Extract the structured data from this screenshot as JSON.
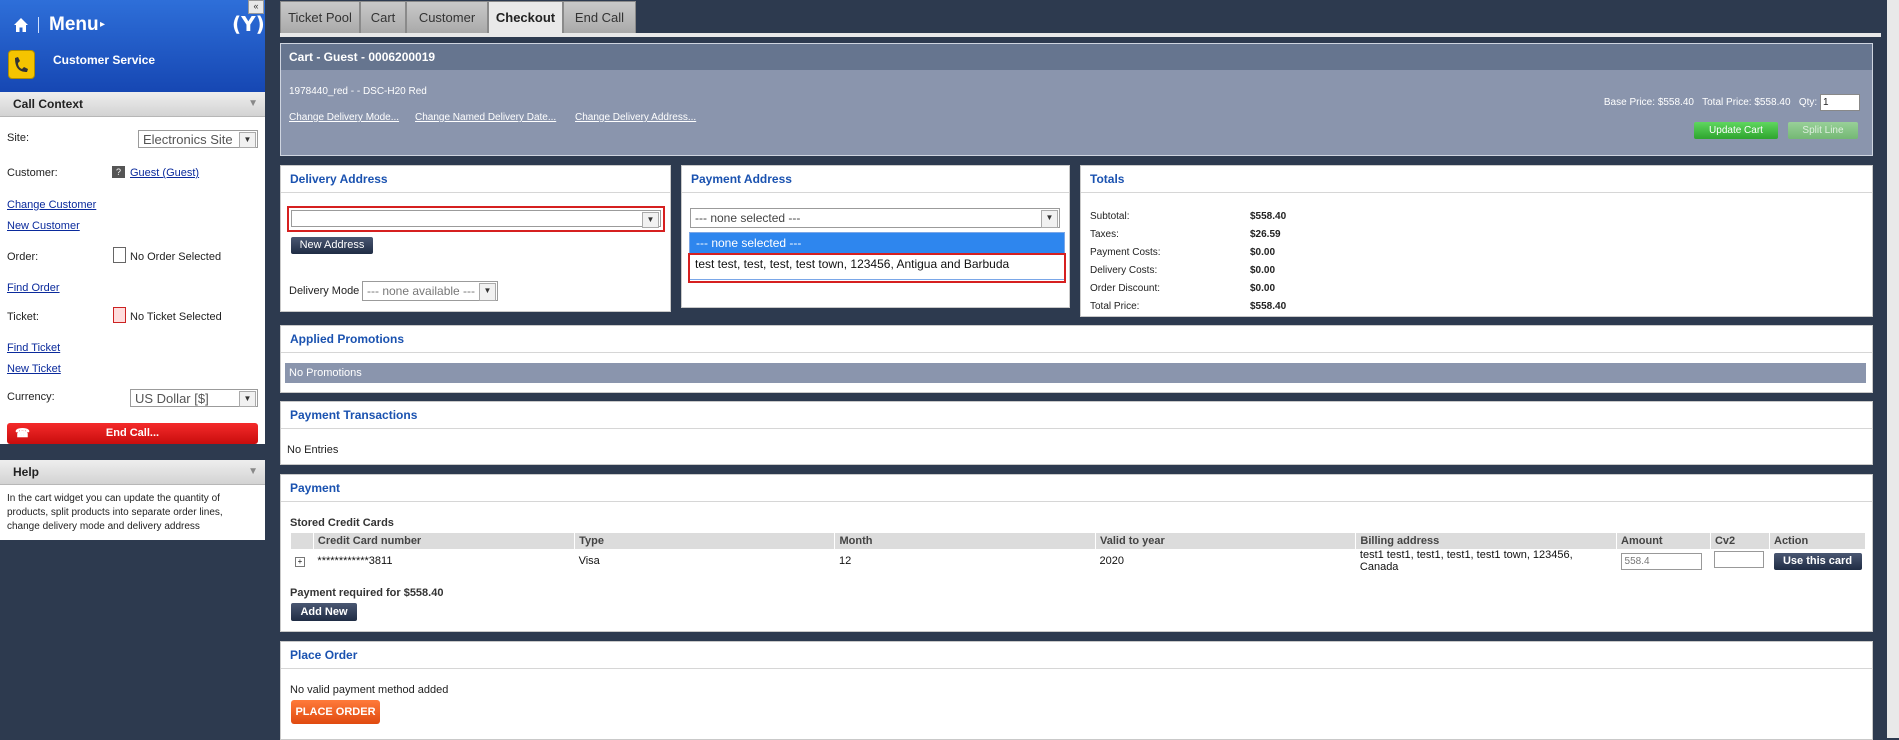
{
  "sidebar": {
    "collapse_label": "«",
    "menu_label": "Menu",
    "menu_arrow": "▸",
    "logo_text": "(Y)",
    "service_label": "Customer Service",
    "call_context": {
      "title": "Call Context",
      "site_label": "Site:",
      "site_value": "Electronics Site",
      "customer_label": "Customer:",
      "customer_value": "Guest (Guest)",
      "change_customer": "Change Customer",
      "new_customer": "New Customer",
      "order_label": "Order:",
      "order_value": "No Order Selected",
      "find_order": "Find Order",
      "ticket_label": "Ticket:",
      "ticket_value": "No Ticket Selected",
      "find_ticket": "Find Ticket",
      "new_ticket": "New Ticket",
      "currency_label": "Currency:",
      "currency_value": "US Dollar [$]",
      "end_call": "End Call..."
    },
    "help": {
      "title": "Help",
      "text": "In the cart widget you can update the quantity of products, split products into separate order lines, change delivery mode and delivery address"
    }
  },
  "tabs": [
    "Ticket Pool",
    "Cart",
    "Customer",
    "Checkout",
    "End Call"
  ],
  "active_tab": "Checkout",
  "cart": {
    "title": "Cart - Guest - 0006200019",
    "product": "1978440_red - - DSC-H20 Red",
    "links": [
      "Change Delivery Mode...",
      "Change Named Delivery Date...",
      "Change Delivery Address..."
    ],
    "base_price_label": "Base Price:",
    "base_price": "$558.40",
    "total_price_label": "Total Price:",
    "total_price": "$558.40",
    "qty_label": "Qty:",
    "qty_value": "1",
    "update_cart": "Update Cart",
    "split_line": "Split Line"
  },
  "delivery": {
    "title": "Delivery Address",
    "address_value": "",
    "new_address": "New Address",
    "mode_label": "Delivery Mode",
    "mode_value": "--- none available ---"
  },
  "payment_address": {
    "title": "Payment Address",
    "selected": "--- none selected ---",
    "options": [
      "--- none selected ---",
      "test test, test, test, test town, 123456, Antigua and Barbuda"
    ]
  },
  "totals": {
    "title": "Totals",
    "rows": [
      {
        "label": "Subtotal:",
        "value": "$558.40"
      },
      {
        "label": "Taxes:",
        "value": "$26.59"
      },
      {
        "label": "Payment Costs:",
        "value": "$0.00"
      },
      {
        "label": "Delivery Costs:",
        "value": "$0.00"
      },
      {
        "label": "Order Discount:",
        "value": "$0.00"
      },
      {
        "label": "Total Price:",
        "value": "$558.40"
      }
    ]
  },
  "promotions": {
    "title": "Applied Promotions",
    "empty": "No Promotions"
  },
  "transactions": {
    "title": "Payment Transactions",
    "empty": "No Entries"
  },
  "payment": {
    "title": "Payment",
    "stored_label": "Stored Credit Cards",
    "headers": [
      "Credit Card number",
      "Type",
      "Month",
      "Valid to year",
      "Billing address",
      "Amount",
      "Cv2",
      "Action"
    ],
    "card": {
      "expand": "+",
      "number": "************3811",
      "type": "Visa",
      "month": "12",
      "year": "2020",
      "address": "test1 test1, test1, test1, test1 town, 123456, Canada",
      "amount": "558.4",
      "cv2": "",
      "action": "Use this card"
    },
    "required_text": "Payment required for $558.40",
    "add_new": "Add New"
  },
  "place_order": {
    "title": "Place Order",
    "message": "No valid payment method added",
    "button": "PLACE ORDER"
  },
  "colors": {
    "accent_blue": "#1a52b0",
    "end_call_red": "#d91414",
    "update_green": "#3cb13c",
    "place_order_orange": "#f05a1c"
  }
}
